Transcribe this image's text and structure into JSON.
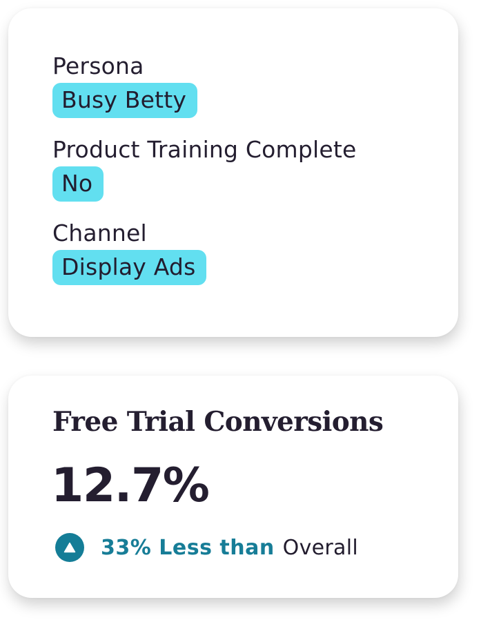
{
  "attributes": [
    {
      "label": "Persona",
      "value": "Busy Betty"
    },
    {
      "label": "Product Training Complete",
      "value": "No"
    },
    {
      "label": "Channel",
      "value": "Display Ads"
    }
  ],
  "metric": {
    "title": "Free Trial Conversions",
    "value": "12.7%",
    "comparison": {
      "icon": "triangle-up-icon",
      "delta": "33% Less than",
      "baseline": "Overall"
    }
  },
  "colors": {
    "tag_background": "#62dff0",
    "accent": "#177d97",
    "text": "#221c2e",
    "card": "#ffffff"
  }
}
